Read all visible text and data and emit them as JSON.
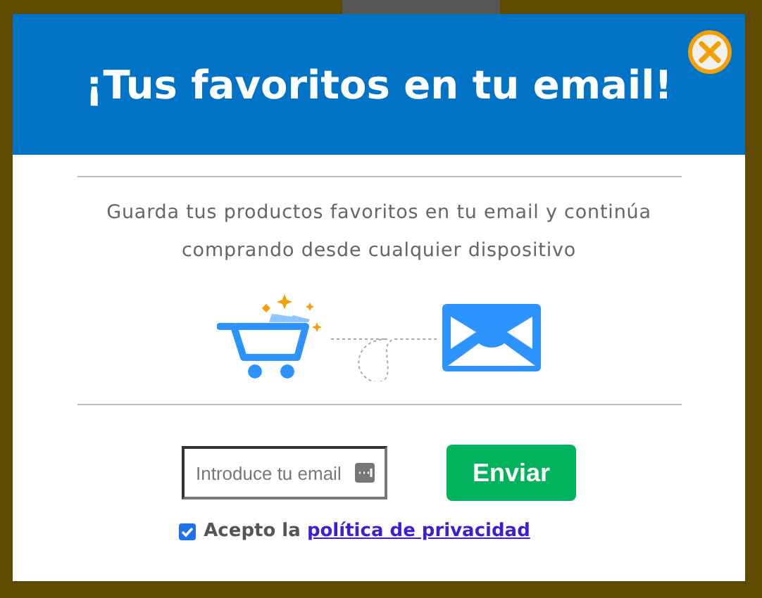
{
  "dialog": {
    "title": "¡Tus favoritos en tu email!",
    "description": "Guarda tus productos favoritos en tu email y continúa comprando desde cualquier dispositivo",
    "email_field": {
      "placeholder": "Introduce tu email"
    },
    "submit_button": "Enviar",
    "consent": {
      "checked": true,
      "text": "Acepto la",
      "link": "política de privacidad"
    }
  }
}
